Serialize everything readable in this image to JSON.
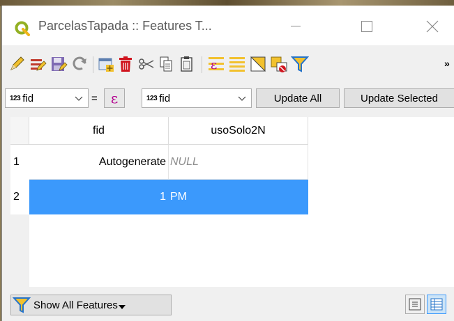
{
  "window": {
    "title": "ParcelasTapada :: Features T..."
  },
  "toolbar": {
    "icons": [
      "pencil-icon",
      "multi-edit-icon",
      "save-edits-icon",
      "reload-icon",
      "add-feature-icon",
      "delete-feature-icon",
      "cut-icon",
      "copy-icon",
      "paste-icon",
      "expression-select-icon",
      "select-all-icon",
      "invert-selection-icon",
      "deselect-icon",
      "filter-icon"
    ],
    "overflow_label": "»"
  },
  "filter_bar": {
    "field_type": "123",
    "field_name": "fid",
    "operator": "=",
    "expression_symbol": "ε",
    "target_type": "123",
    "target_field": "fid",
    "update_all_label": "Update All",
    "update_selected_label": "Update Selected"
  },
  "table": {
    "columns": [
      "fid",
      "usoSolo2N"
    ],
    "rows": [
      {
        "index": "1",
        "fid": "Autogenerate",
        "usoSolo2N": "NULL",
        "selected": false
      },
      {
        "index": "2",
        "fid": "1",
        "usoSolo2N": "PM",
        "selected": true
      }
    ]
  },
  "footer": {
    "show_all_label": "Show All Features"
  },
  "colors": {
    "selection": "#3b99fc",
    "title_text": "#5a5a5a",
    "null_text": "#8c8c8c"
  }
}
